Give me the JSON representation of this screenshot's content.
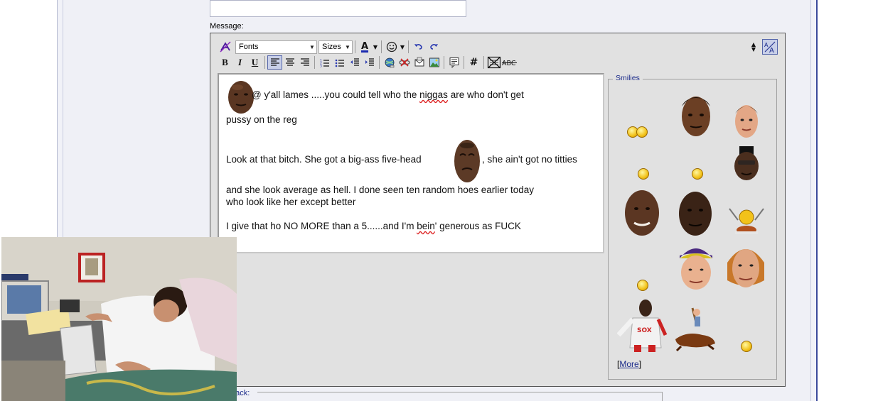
{
  "form": {
    "message_label": "Message:",
    "trackback_label": "back:"
  },
  "toolbar": {
    "font_select": "Fonts",
    "size_select": "Sizes",
    "bold": "B",
    "italic": "I",
    "underline": "U",
    "hash": "#"
  },
  "message": {
    "line1": " @ y'all lames .....you could tell who the ",
    "line1_spell": "niggas",
    "line1_end": " are who don't get",
    "line2": "pussy on the reg",
    "line3_start": "Look at that bitch. She got a big-ass five-head",
    "line3_end": ", she ain't got no titties",
    "line4": "and she look average as hell. I done seen ten random hoes earlier today",
    "line5": "who look like her except better",
    "line6_start": "I give that ho NO MORE than a 5......and I'm ",
    "line6_spell": "bein",
    "line6_end": "' generous as FUCK"
  },
  "smilies": {
    "title": "Smilies",
    "more_open": "[",
    "more_link": "More",
    "more_close": "]"
  },
  "colors": {
    "accent": "#1a2a8a",
    "editor_bg": "#e1e1e1",
    "panel_bg": "#eff0f6",
    "panel_border": "#3b4a9c"
  }
}
